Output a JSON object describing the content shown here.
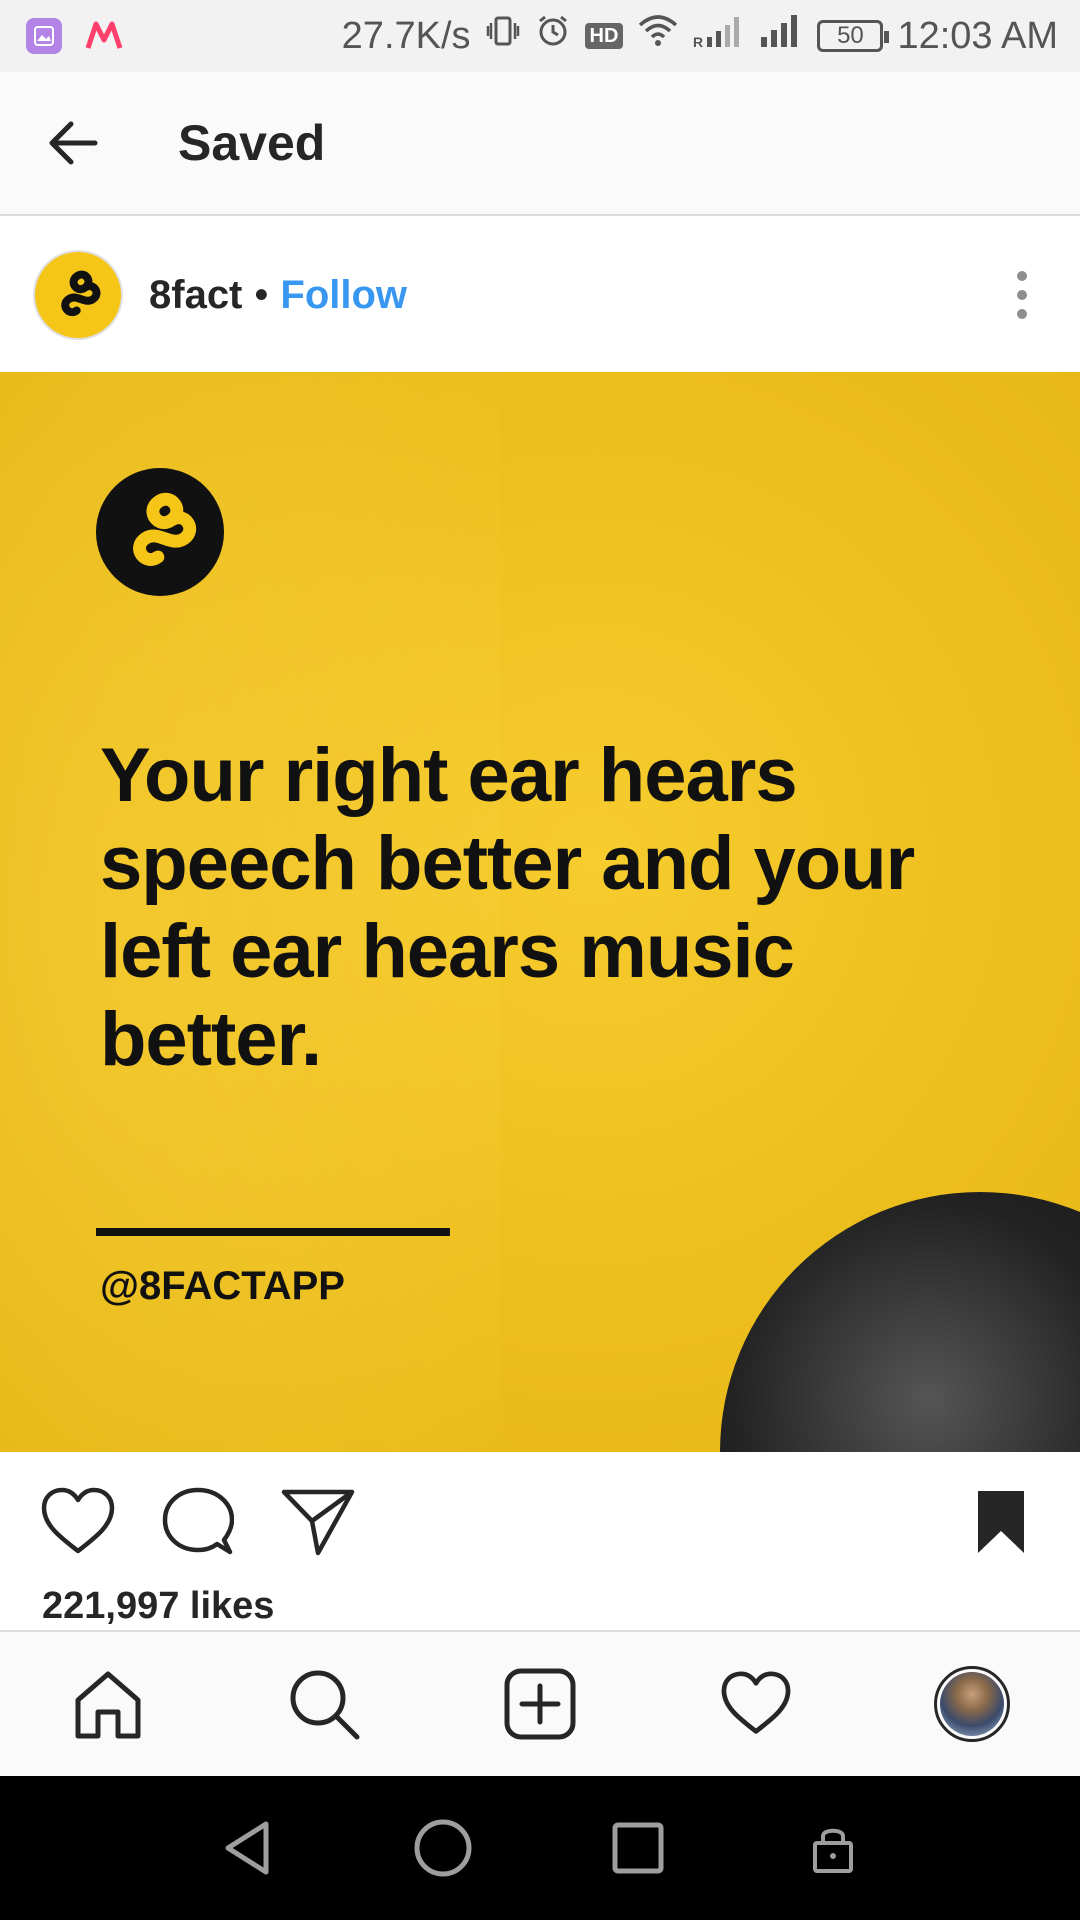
{
  "status_bar": {
    "network_speed": "27.7K/s",
    "hd_label": "HD",
    "battery_level": "50",
    "time": "12:03 AM",
    "icons": [
      "gallery-app-icon",
      "myntra-app-icon",
      "vibrate-icon",
      "alarm-icon",
      "hd-icon",
      "wifi-icon",
      "signal-icon",
      "signal-icon",
      "battery-icon"
    ]
  },
  "top_bar": {
    "title": "Saved",
    "back_icon": "arrow-left-icon"
  },
  "post": {
    "username": "8fact",
    "separator": "•",
    "follow_label": "Follow",
    "more_icon": "more-vertical-icon",
    "image": {
      "fact_text": "Your right ear hears speech better and your left ear hears music better.",
      "handle": "@8FACTAPP",
      "background_color": "#f1c21f",
      "logo": "8fact-logo"
    },
    "actions": {
      "like_icon": "heart-icon",
      "comment_icon": "comment-icon",
      "share_icon": "send-icon",
      "save_icon": "bookmark-filled-icon"
    },
    "likes_label": "221,997 likes"
  },
  "bottom_nav": {
    "items": [
      "home-icon",
      "search-icon",
      "add-post-icon",
      "activity-heart-icon",
      "profile-avatar"
    ]
  },
  "system_nav": {
    "items": [
      "back-triangle-icon",
      "home-circle-icon",
      "recents-square-icon",
      "lock-icon"
    ]
  },
  "colors": {
    "follow_blue": "#3897f0",
    "brand_yellow": "#f5c518",
    "text_dark": "#262626"
  }
}
